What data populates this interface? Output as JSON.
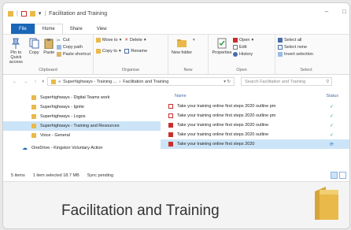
{
  "window": {
    "title": "Facilitation and Training",
    "controls": [
      "–",
      "□"
    ]
  },
  "menu": {
    "file": "File",
    "tabs": [
      "Home",
      "Share",
      "View"
    ]
  },
  "ribbon": {
    "pin": "Pin to Quick access",
    "copy": "Copy",
    "paste": "Paste",
    "cut": "Cut",
    "copy_path": "Copy path",
    "paste_shortcut": "Paste shortcut",
    "clipboard": "Clipboard",
    "move_to": "Move to",
    "copy_to": "Copy to",
    "delete": "Delete",
    "rename": "Rename",
    "organise": "Organise",
    "new_folder": "New folder",
    "new": "New",
    "properties": "Properties",
    "open": "Open",
    "edit": "Edit",
    "history": "History",
    "open_group": "Open",
    "select_all": "Select all",
    "select_none": "Select none",
    "invert_selection": "Invert selection",
    "select": "Select"
  },
  "address": {
    "nav": "← → ↑",
    "path1": "Superhighways - Training ...",
    "sep": "›",
    "path2": "Facilitation and Training",
    "search_placeholder": "Search Facilitation and Training"
  },
  "nav_pane": {
    "items": [
      "Superhighways - Digital Teams work",
      "Superhighways - Ignite",
      "Superhighways - Logos",
      "Superhighways - Training and Resources",
      "Voice - General"
    ],
    "onedrive": "OneDrive - Kingston Voluntary Action"
  },
  "files": {
    "col_name": "Name",
    "col_status": "Status",
    "rows": [
      {
        "name": "Take your training online first steps 2020 outline pm",
        "status": "✓"
      },
      {
        "name": "Take your training online first steps 2020 outline pm",
        "status": "✓"
      },
      {
        "name": "Take your training online first steps 2020 outline",
        "status": "✓"
      },
      {
        "name": "Take your training online first steps 2020 outline",
        "status": "✓"
      },
      {
        "name": "Take your training online first steps 2020",
        "status": "⟳"
      }
    ]
  },
  "status_bar": {
    "items": "5 items",
    "selected": "1 item selected  18.7 MB",
    "sync": "Sync pending"
  },
  "caption": {
    "title": "Facilitation and Training"
  },
  "colors": {
    "accent": "#1a67b8",
    "selection": "#cce4f7",
    "folder": "#e9b94a",
    "ok": "#2e9e46",
    "pdf": "#c9302c"
  }
}
